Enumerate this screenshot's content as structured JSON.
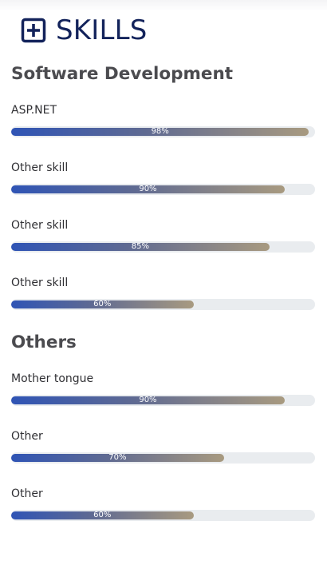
{
  "header": {
    "icon": "plus-square-icon",
    "title": "SKILLS",
    "color": "#13235b"
  },
  "bar_colors": {
    "start": "#2f54b5",
    "end": "#a89a80",
    "track": "#e9ecef"
  },
  "sections": [
    {
      "title": "Software Development",
      "skills": [
        {
          "label": "ASP.NET",
          "percent": 98,
          "percent_label": "98%"
        },
        {
          "label": "Other skill",
          "percent": 90,
          "percent_label": "90%"
        },
        {
          "label": "Other skill",
          "percent": 85,
          "percent_label": "85%"
        },
        {
          "label": "Other skill",
          "percent": 60,
          "percent_label": "60%"
        }
      ]
    },
    {
      "title": "Others",
      "skills": [
        {
          "label": "Mother tongue",
          "percent": 90,
          "percent_label": "90%"
        },
        {
          "label": "Other",
          "percent": 70,
          "percent_label": "70%"
        },
        {
          "label": "Other",
          "percent": 60,
          "percent_label": "60%"
        }
      ]
    }
  ]
}
